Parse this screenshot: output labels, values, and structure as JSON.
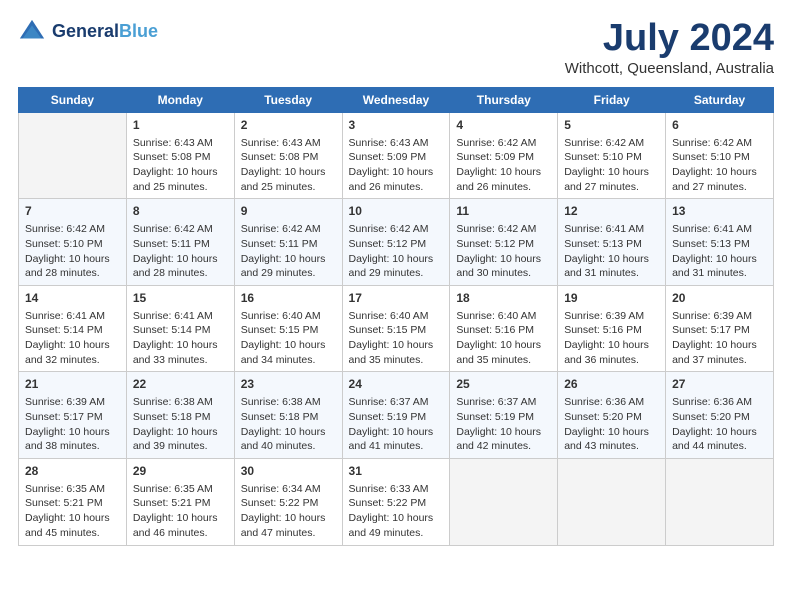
{
  "header": {
    "logo_line1": "General",
    "logo_line2": "Blue",
    "title": "July 2024",
    "subtitle": "Withcott, Queensland, Australia"
  },
  "days_of_week": [
    "Sunday",
    "Monday",
    "Tuesday",
    "Wednesday",
    "Thursday",
    "Friday",
    "Saturday"
  ],
  "weeks": [
    [
      {
        "day": "",
        "info": ""
      },
      {
        "day": "1",
        "info": "Sunrise: 6:43 AM\nSunset: 5:08 PM\nDaylight: 10 hours\nand 25 minutes."
      },
      {
        "day": "2",
        "info": "Sunrise: 6:43 AM\nSunset: 5:08 PM\nDaylight: 10 hours\nand 25 minutes."
      },
      {
        "day": "3",
        "info": "Sunrise: 6:43 AM\nSunset: 5:09 PM\nDaylight: 10 hours\nand 26 minutes."
      },
      {
        "day": "4",
        "info": "Sunrise: 6:42 AM\nSunset: 5:09 PM\nDaylight: 10 hours\nand 26 minutes."
      },
      {
        "day": "5",
        "info": "Sunrise: 6:42 AM\nSunset: 5:10 PM\nDaylight: 10 hours\nand 27 minutes."
      },
      {
        "day": "6",
        "info": "Sunrise: 6:42 AM\nSunset: 5:10 PM\nDaylight: 10 hours\nand 27 minutes."
      }
    ],
    [
      {
        "day": "7",
        "info": "Sunrise: 6:42 AM\nSunset: 5:10 PM\nDaylight: 10 hours\nand 28 minutes."
      },
      {
        "day": "8",
        "info": "Sunrise: 6:42 AM\nSunset: 5:11 PM\nDaylight: 10 hours\nand 28 minutes."
      },
      {
        "day": "9",
        "info": "Sunrise: 6:42 AM\nSunset: 5:11 PM\nDaylight: 10 hours\nand 29 minutes."
      },
      {
        "day": "10",
        "info": "Sunrise: 6:42 AM\nSunset: 5:12 PM\nDaylight: 10 hours\nand 29 minutes."
      },
      {
        "day": "11",
        "info": "Sunrise: 6:42 AM\nSunset: 5:12 PM\nDaylight: 10 hours\nand 30 minutes."
      },
      {
        "day": "12",
        "info": "Sunrise: 6:41 AM\nSunset: 5:13 PM\nDaylight: 10 hours\nand 31 minutes."
      },
      {
        "day": "13",
        "info": "Sunrise: 6:41 AM\nSunset: 5:13 PM\nDaylight: 10 hours\nand 31 minutes."
      }
    ],
    [
      {
        "day": "14",
        "info": "Sunrise: 6:41 AM\nSunset: 5:14 PM\nDaylight: 10 hours\nand 32 minutes."
      },
      {
        "day": "15",
        "info": "Sunrise: 6:41 AM\nSunset: 5:14 PM\nDaylight: 10 hours\nand 33 minutes."
      },
      {
        "day": "16",
        "info": "Sunrise: 6:40 AM\nSunset: 5:15 PM\nDaylight: 10 hours\nand 34 minutes."
      },
      {
        "day": "17",
        "info": "Sunrise: 6:40 AM\nSunset: 5:15 PM\nDaylight: 10 hours\nand 35 minutes."
      },
      {
        "day": "18",
        "info": "Sunrise: 6:40 AM\nSunset: 5:16 PM\nDaylight: 10 hours\nand 35 minutes."
      },
      {
        "day": "19",
        "info": "Sunrise: 6:39 AM\nSunset: 5:16 PM\nDaylight: 10 hours\nand 36 minutes."
      },
      {
        "day": "20",
        "info": "Sunrise: 6:39 AM\nSunset: 5:17 PM\nDaylight: 10 hours\nand 37 minutes."
      }
    ],
    [
      {
        "day": "21",
        "info": "Sunrise: 6:39 AM\nSunset: 5:17 PM\nDaylight: 10 hours\nand 38 minutes."
      },
      {
        "day": "22",
        "info": "Sunrise: 6:38 AM\nSunset: 5:18 PM\nDaylight: 10 hours\nand 39 minutes."
      },
      {
        "day": "23",
        "info": "Sunrise: 6:38 AM\nSunset: 5:18 PM\nDaylight: 10 hours\nand 40 minutes."
      },
      {
        "day": "24",
        "info": "Sunrise: 6:37 AM\nSunset: 5:19 PM\nDaylight: 10 hours\nand 41 minutes."
      },
      {
        "day": "25",
        "info": "Sunrise: 6:37 AM\nSunset: 5:19 PM\nDaylight: 10 hours\nand 42 minutes."
      },
      {
        "day": "26",
        "info": "Sunrise: 6:36 AM\nSunset: 5:20 PM\nDaylight: 10 hours\nand 43 minutes."
      },
      {
        "day": "27",
        "info": "Sunrise: 6:36 AM\nSunset: 5:20 PM\nDaylight: 10 hours\nand 44 minutes."
      }
    ],
    [
      {
        "day": "28",
        "info": "Sunrise: 6:35 AM\nSunset: 5:21 PM\nDaylight: 10 hours\nand 45 minutes."
      },
      {
        "day": "29",
        "info": "Sunrise: 6:35 AM\nSunset: 5:21 PM\nDaylight: 10 hours\nand 46 minutes."
      },
      {
        "day": "30",
        "info": "Sunrise: 6:34 AM\nSunset: 5:22 PM\nDaylight: 10 hours\nand 47 minutes."
      },
      {
        "day": "31",
        "info": "Sunrise: 6:33 AM\nSunset: 5:22 PM\nDaylight: 10 hours\nand 49 minutes."
      },
      {
        "day": "",
        "info": ""
      },
      {
        "day": "",
        "info": ""
      },
      {
        "day": "",
        "info": ""
      }
    ]
  ]
}
